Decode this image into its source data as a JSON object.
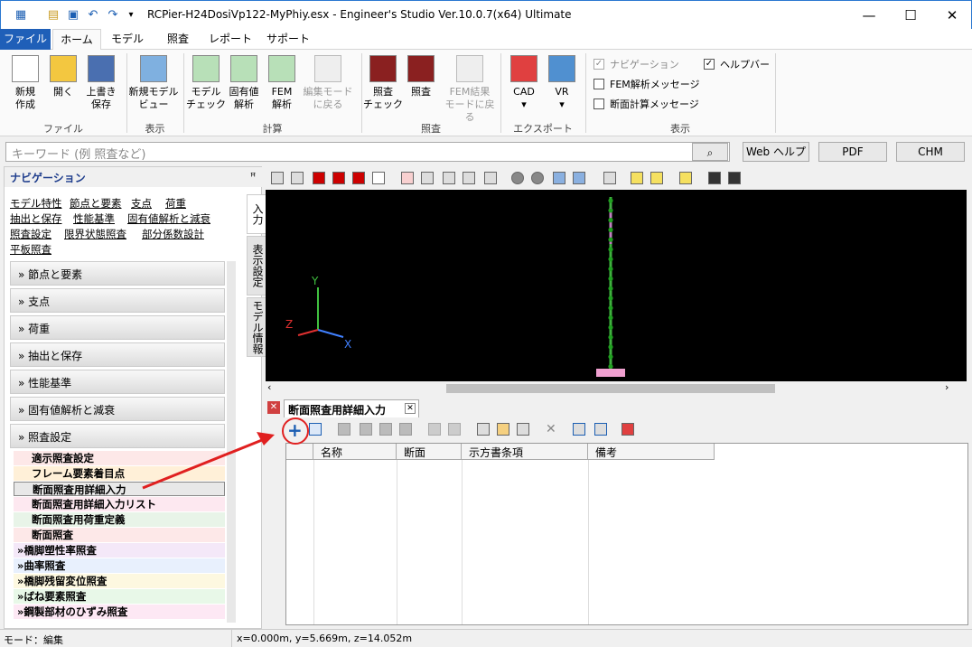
{
  "window": {
    "title": "RCPier-H24DosiVp122-MyPhiy.esx - Engineer's Studio Ver.10.0.7(x64) Ultimate",
    "minimize": "—",
    "maximize": "☐",
    "close": "✕"
  },
  "menu": [
    "ファイル",
    "ホーム",
    "モデル",
    "照査",
    "レポート",
    "サポート"
  ],
  "ribbon": {
    "buttons": [
      {
        "label1": "新規",
        "label2": "作成"
      },
      {
        "label1": "開く",
        "label2": ""
      },
      {
        "label1": "上書き",
        "label2": "保存"
      },
      {
        "label1": "新規モデル",
        "label2": "ビュー"
      },
      {
        "label1": "モデル",
        "label2": "チェック"
      },
      {
        "label1": "固有値",
        "label2": "解析"
      },
      {
        "label1": "FEM",
        "label2": "解析"
      },
      {
        "label1": "編集モード",
        "label2": "に戻る"
      },
      {
        "label1": "照査",
        "label2": "チェック"
      },
      {
        "label1": "照査",
        "label2": ""
      },
      {
        "label1": "FEM結果",
        "label2": "モードに戻る"
      },
      {
        "label1": "CAD",
        "label2": "▾"
      },
      {
        "label1": "VR",
        "label2": "▾"
      }
    ],
    "groups": [
      "ファイル",
      "表示",
      "計算",
      "照査",
      "エクスポート",
      "表示"
    ],
    "checks": [
      {
        "label": "ナビゲーション",
        "checked": "✓"
      },
      {
        "label": "FEM解析メッセージ",
        "checked": ""
      },
      {
        "label": "断面計算メッセージ",
        "checked": ""
      },
      {
        "label": "ヘルプバー",
        "checked": "✓"
      }
    ]
  },
  "search": {
    "placeholder": "キーワード (例 照査など)",
    "web_help": "Web ヘルプ",
    "pdf": "PDF",
    "chm": "CHM"
  },
  "nav": {
    "title": "ナビゲーション",
    "pin": "ꟸ",
    "links": [
      "モデル特性",
      "節点と要素",
      "支点",
      "荷重",
      "抽出と保存",
      "性能基準",
      "固有値解析と減衰",
      "照査設定",
      "限界状態照査",
      "部分係数設計",
      "平板照査"
    ],
    "sections": [
      "節点と要素",
      "支点",
      "荷重",
      "抽出と保存",
      "性能基準",
      "固有値解析と減衰",
      "照査設定"
    ],
    "chevron": "»",
    "subitems": [
      "適示照査設定",
      "フレーム要素着目点",
      "断面照査用詳細入力",
      "断面照査用詳細入力リスト",
      "断面照査用荷重定義",
      "断面照査",
      "橋脚塑性率照査",
      "曲率照査",
      "橋脚残留変位照査",
      "ばね要素照査",
      "鋼製部材のひずみ照査"
    ],
    "tabs": [
      "入力",
      "表示設定",
      "モデル情報"
    ]
  },
  "viewport": {
    "axis_x": "X",
    "axis_y": "Y",
    "axis_z": "Z"
  },
  "panel": {
    "tab_title": "断面照査用詳細入力",
    "add": "+",
    "columns": [
      "名称",
      "断面",
      "示方書条項",
      "備考"
    ]
  },
  "status": {
    "mode": "モード：編集",
    "coords": "x=0.000m, y=5.669m, z=14.052m"
  }
}
